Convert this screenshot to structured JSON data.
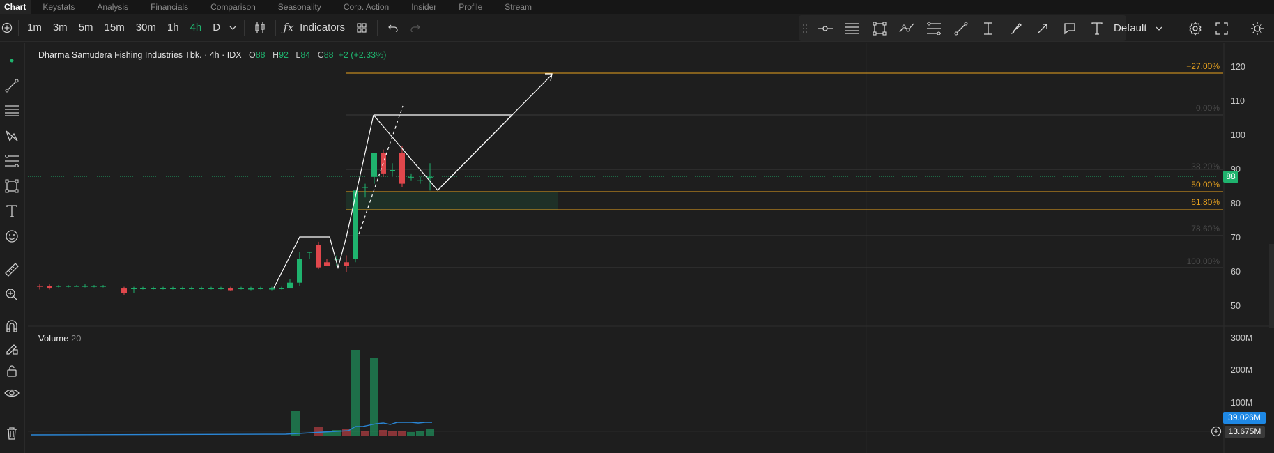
{
  "nav": {
    "tabs": [
      "Chart",
      "Keystats",
      "Analysis",
      "Financials",
      "Comparison",
      "Seasonality",
      "Corp. Action",
      "Insider",
      "Profile",
      "Stream"
    ]
  },
  "toolbar": {
    "intervals": [
      "1m",
      "3m",
      "5m",
      "15m",
      "30m",
      "1h",
      "4h",
      "D"
    ],
    "active_interval": "4h",
    "indicators_label": "Indicators",
    "template_label": "Default"
  },
  "legend": {
    "symbol": "Dharma Samudera Fishing Industries Tbk. · 4h · IDX",
    "open_key": "O",
    "open": "88",
    "high_key": "H",
    "high": "92",
    "low_key": "L",
    "low": "84",
    "close_key": "C",
    "close": "88",
    "change": "+2 (+2.33%)"
  },
  "volume_legend": {
    "label": "Volume",
    "period": "20"
  },
  "price_axis": [
    "120",
    "110",
    "100",
    "90",
    "80",
    "70",
    "60",
    "50"
  ],
  "volume_axis": [
    "300M",
    "200M",
    "100M"
  ],
  "fib_levels": [
    {
      "label": "−27.00%",
      "color": "#e8a21f"
    },
    {
      "label": "0.00%",
      "color": "#4a4a4a"
    },
    {
      "label": "38.20%",
      "color": "#4a4a4a"
    },
    {
      "label": "50.00%",
      "color": "#e8a21f"
    },
    {
      "label": "61.80%",
      "color": "#e8a21f"
    },
    {
      "label": "78.60%",
      "color": "#4a4a4a"
    },
    {
      "label": "100.00%",
      "color": "#4a4a4a"
    }
  ],
  "badges": {
    "last_price": "88",
    "volume_ma": "39.026M",
    "volume_last": "13.675M"
  },
  "colors": {
    "up": "#1fb36e",
    "down": "#e0474c",
    "fib": "#e8a21f",
    "volume_ma_line": "#2a86d6",
    "accent_blue": "#1e88e5"
  }
}
